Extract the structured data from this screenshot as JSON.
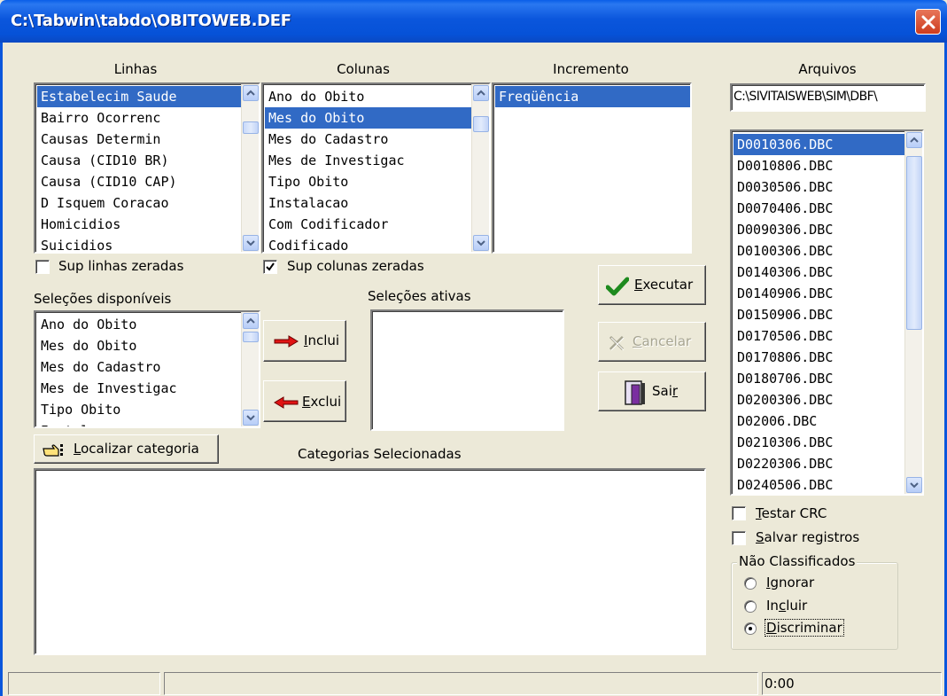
{
  "window": {
    "title": "C:\\Tabwin\\tabdo\\OBITOWEB.DEF",
    "close_glyph": "✕"
  },
  "labels": {
    "linhas": "Linhas",
    "colunas": "Colunas",
    "incremento": "Incremento",
    "arquivos": "Arquivos",
    "selecoes_disponiveis": "Seleções disponíveis",
    "selecoes_ativas": "Seleções ativas",
    "categorias_selecionadas": "Categorias Selecionadas"
  },
  "linhas": {
    "items": [
      "Estabelecim Saude",
      "Bairro Ocorrenc",
      "Causas Determin",
      "Causa (CID10 BR)",
      "Causa (CID10 CAP)",
      "D Isquem Coracao",
      "Homicidios",
      "Suicidios"
    ],
    "selected": "Estabelecim Saude"
  },
  "colunas": {
    "items": [
      "Ano do Obito",
      "Mes do Obito",
      "Mes do Cadastro",
      "Mes de Investigac",
      "Tipo Obito",
      "Instalacao",
      "Com Codificador",
      "Codificado"
    ],
    "selected": "Mes do Obito"
  },
  "incremento": {
    "items": [
      "Freqüência"
    ],
    "selected": "Freqüência"
  },
  "arquivos": {
    "path": "C:\\SIVITAISWEB\\SIM\\DBF\\",
    "files": [
      "D0010306.DBC",
      "D0010806.DBC",
      "D0030506.DBC",
      "D0070406.DBC",
      "D0090306.DBC",
      "D0100306.DBC",
      "D0140306.DBC",
      "D0140906.DBC",
      "D0150906.DBC",
      "D0170506.DBC",
      "D0170806.DBC",
      "D0180706.DBC",
      "D0200306.DBC",
      "D02006.DBC",
      "D0210306.DBC",
      "D0220306.DBC",
      "D0240506.DBC"
    ],
    "selected": "D0010306.DBC"
  },
  "checkboxes": {
    "sup_linhas_zeradas": {
      "label": "Sup linhas zeradas",
      "checked": false
    },
    "sup_colunas_zeradas": {
      "label": "Sup colunas zeradas",
      "checked": true
    },
    "testar_crc": {
      "label": "Testar CRC",
      "accel": "T",
      "rest": "estar CRC",
      "checked": false
    },
    "salvar_registros": {
      "label": "Salvar registros",
      "accel": "S",
      "rest": "alvar registros",
      "checked": false
    }
  },
  "selecoes_disponiveis": {
    "items": [
      "Ano do Obito",
      "Mes do Obito",
      "Mes do Cadastro",
      "Mes de Investigac",
      "Tipo Obito",
      "Instalacao"
    ]
  },
  "selecoes_ativas": {
    "items": []
  },
  "categorias_selecionadas": {
    "items": []
  },
  "buttons": {
    "executar": {
      "pre": "",
      "accel": "E",
      "post": "xecutar",
      "icon": "checkmark-icon",
      "enabled": true
    },
    "cancelar": {
      "pre": "",
      "accel": "C",
      "post": "ancelar",
      "icon": "cancel-x-icon",
      "enabled": false
    },
    "sair": {
      "pre": "Sai",
      "accel": "r",
      "post": "",
      "icon": "exit-door-icon",
      "enabled": true
    },
    "inclui": {
      "pre": "",
      "accel": "I",
      "post": "nclui",
      "icon": "arrow-right-icon",
      "enabled": true
    },
    "exclui": {
      "pre": "",
      "accel": "E",
      "post": "xclui",
      "icon": "arrow-left-icon",
      "enabled": true
    },
    "localizar": {
      "pre": "",
      "accel": "L",
      "post": "ocalizar categoria",
      "icon": "pointing-hand-icon",
      "enabled": true
    }
  },
  "nao_classificados": {
    "legend": "Não Classificados",
    "options": [
      {
        "label": "Ignorar",
        "pre": "",
        "accel": "I",
        "post": "gnorar",
        "selected": false
      },
      {
        "label": "Incluir",
        "pre": "In",
        "accel": "c",
        "post": "luir",
        "selected": false
      },
      {
        "label": "Discriminar",
        "pre": "",
        "accel": "D",
        "post": "iscriminar",
        "selected": true
      }
    ]
  },
  "status": {
    "panel1": "",
    "panel2": "",
    "time": "0:00"
  },
  "colors": {
    "title_blue": "#0b56dc",
    "selection": "#316ac5",
    "face": "#ece9d8",
    "close_red": "#cd3c1e"
  }
}
